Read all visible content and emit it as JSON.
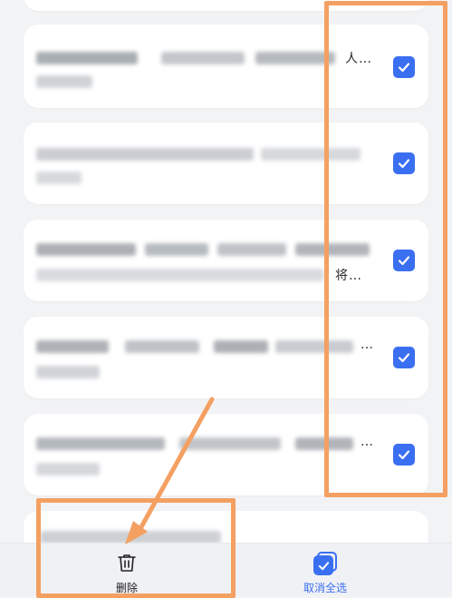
{
  "list": {
    "items": [
      {
        "tail_text": "人…",
        "checked": true
      },
      {
        "tail_text": "",
        "checked": true
      },
      {
        "tail_text": "将…",
        "checked": true
      },
      {
        "tail_text": "…",
        "checked": true
      },
      {
        "tail_text": "…",
        "checked": true
      }
    ]
  },
  "bottom_bar": {
    "delete_label": "删除",
    "deselect_all_label": "取消全选"
  },
  "colors": {
    "accent": "#3a6ff2",
    "annotation": "#f4a062"
  }
}
